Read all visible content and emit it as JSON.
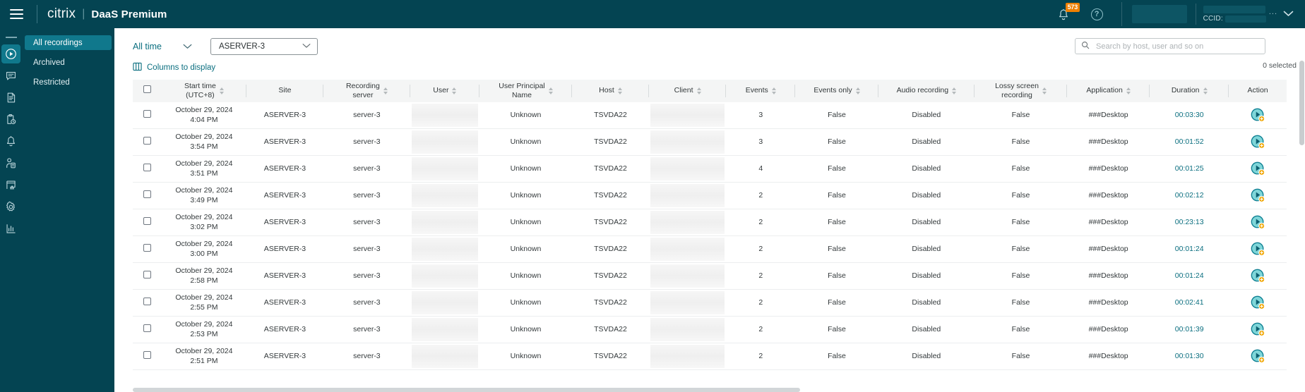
{
  "topbar": {
    "menu_icon": "hamburger-menu-icon",
    "logo": "citrix",
    "logo_separator": "|",
    "product": "DaaS Premium",
    "notification_icon": "bell-icon",
    "notification_count": "573",
    "help_icon": "help-question-icon",
    "ccid_label": "CCID:",
    "account_dots": "...",
    "account_caret_icon": "chevron-down-icon",
    "colors": {
      "bar_bg": "#044452",
      "badge": "#f08000",
      "accent": "#10788c"
    }
  },
  "rail": {
    "items": [
      {
        "name": "recordings",
        "icon": "play-circle-icon",
        "active": true
      },
      {
        "name": "messages",
        "icon": "chat-bubble-icon",
        "active": false
      },
      {
        "name": "reports",
        "icon": "document-lines-icon",
        "active": false
      },
      {
        "name": "scheduled",
        "icon": "clipboard-clock-icon",
        "active": false
      },
      {
        "name": "alerts",
        "icon": "bell-icon",
        "active": false
      },
      {
        "name": "users",
        "icon": "person-document-icon",
        "active": false
      },
      {
        "name": "monitoring",
        "icon": "monitor-warning-icon",
        "active": false
      },
      {
        "name": "settings",
        "icon": "gear-icon",
        "active": false
      },
      {
        "name": "analytics",
        "icon": "bar-chart-icon",
        "active": false
      }
    ]
  },
  "subnav": {
    "items": [
      {
        "label": "All recordings",
        "active": true
      },
      {
        "label": "Archived",
        "active": false
      },
      {
        "label": "Restricted",
        "active": false
      }
    ]
  },
  "filters": {
    "time_label": "All time",
    "time_caret_icon": "chevron-down-icon",
    "server_value": "ASERVER-3",
    "server_caret_icon": "chevron-down-icon"
  },
  "search": {
    "icon": "search-icon",
    "placeholder": "Search by host, user and so on",
    "value": ""
  },
  "toolbar": {
    "columns_icon": "columns-icon",
    "columns_label": "Columns to display",
    "selected_text": "0 selected"
  },
  "table": {
    "columns": [
      {
        "key": "check",
        "label": "",
        "sortable": false,
        "name": "select-all-checkbox-header"
      },
      {
        "key": "start",
        "label": "Start time\n(UTC+8)",
        "sortable": true,
        "name": "column-start-time"
      },
      {
        "key": "site",
        "label": "Site",
        "sortable": false,
        "name": "column-site"
      },
      {
        "key": "recsrv",
        "label": "Recording\nserver",
        "sortable": true,
        "name": "column-recording-server"
      },
      {
        "key": "user",
        "label": "User",
        "sortable": true,
        "name": "column-user"
      },
      {
        "key": "upn",
        "label": "User Principal\nName",
        "sortable": true,
        "name": "column-user-principal-name"
      },
      {
        "key": "host",
        "label": "Host",
        "sortable": true,
        "name": "column-host"
      },
      {
        "key": "client",
        "label": "Client",
        "sortable": true,
        "name": "column-client"
      },
      {
        "key": "events",
        "label": "Events",
        "sortable": true,
        "name": "column-events"
      },
      {
        "key": "evonly",
        "label": "Events only",
        "sortable": true,
        "name": "column-events-only"
      },
      {
        "key": "audio",
        "label": "Audio recording",
        "sortable": true,
        "name": "column-audio-recording"
      },
      {
        "key": "lossy",
        "label": "Lossy screen\nrecording",
        "sortable": true,
        "name": "column-lossy-screen-recording"
      },
      {
        "key": "app",
        "label": "Application",
        "sortable": true,
        "name": "column-application"
      },
      {
        "key": "dur",
        "label": "Duration",
        "sortable": true,
        "name": "column-duration"
      },
      {
        "key": "action",
        "label": "Action",
        "sortable": false,
        "name": "column-action"
      }
    ],
    "rows": [
      {
        "date": "October 29, 2024",
        "time": "4:04 PM",
        "site": "ASERVER-3",
        "recsrv": "server-3",
        "user": "",
        "upn": "Unknown",
        "host": "TSVDA22",
        "client": "",
        "events": "3",
        "evonly": "False",
        "audio": "Disabled",
        "lossy": "False",
        "app": "###Desktop",
        "dur": "00:03:30",
        "action": "play-recording-button"
      },
      {
        "date": "October 29, 2024",
        "time": "3:54 PM",
        "site": "ASERVER-3",
        "recsrv": "server-3",
        "user": "",
        "upn": "Unknown",
        "host": "TSVDA22",
        "client": "",
        "events": "3",
        "evonly": "False",
        "audio": "Disabled",
        "lossy": "False",
        "app": "###Desktop",
        "dur": "00:01:52",
        "action": "play-recording-button"
      },
      {
        "date": "October 29, 2024",
        "time": "3:51 PM",
        "site": "ASERVER-3",
        "recsrv": "server-3",
        "user": "",
        "upn": "Unknown",
        "host": "TSVDA22",
        "client": "",
        "events": "4",
        "evonly": "False",
        "audio": "Disabled",
        "lossy": "False",
        "app": "###Desktop",
        "dur": "00:01:25",
        "action": "play-recording-button"
      },
      {
        "date": "October 29, 2024",
        "time": "3:49 PM",
        "site": "ASERVER-3",
        "recsrv": "server-3",
        "user": "",
        "upn": "Unknown",
        "host": "TSVDA22",
        "client": "",
        "events": "2",
        "evonly": "False",
        "audio": "Disabled",
        "lossy": "False",
        "app": "###Desktop",
        "dur": "00:02:12",
        "action": "play-recording-button"
      },
      {
        "date": "October 29, 2024",
        "time": "3:02 PM",
        "site": "ASERVER-3",
        "recsrv": "server-3",
        "user": "",
        "upn": "Unknown",
        "host": "TSVDA22",
        "client": "",
        "events": "2",
        "evonly": "False",
        "audio": "Disabled",
        "lossy": "False",
        "app": "###Desktop",
        "dur": "00:23:13",
        "action": "play-recording-button"
      },
      {
        "date": "October 29, 2024",
        "time": "3:00 PM",
        "site": "ASERVER-3",
        "recsrv": "server-3",
        "user": "",
        "upn": "Unknown",
        "host": "TSVDA22",
        "client": "",
        "events": "2",
        "evonly": "False",
        "audio": "Disabled",
        "lossy": "False",
        "app": "###Desktop",
        "dur": "00:01:24",
        "action": "play-recording-button"
      },
      {
        "date": "October 29, 2024",
        "time": "2:58 PM",
        "site": "ASERVER-3",
        "recsrv": "server-3",
        "user": "",
        "upn": "Unknown",
        "host": "TSVDA22",
        "client": "",
        "events": "2",
        "evonly": "False",
        "audio": "Disabled",
        "lossy": "False",
        "app": "###Desktop",
        "dur": "00:01:24",
        "action": "play-recording-button"
      },
      {
        "date": "October 29, 2024",
        "time": "2:55 PM",
        "site": "ASERVER-3",
        "recsrv": "server-3",
        "user": "",
        "upn": "Unknown",
        "host": "TSVDA22",
        "client": "",
        "events": "2",
        "evonly": "False",
        "audio": "Disabled",
        "lossy": "False",
        "app": "###Desktop",
        "dur": "00:02:41",
        "action": "play-recording-button"
      },
      {
        "date": "October 29, 2024",
        "time": "2:53 PM",
        "site": "ASERVER-3",
        "recsrv": "server-3",
        "user": "",
        "upn": "Unknown",
        "host": "TSVDA22",
        "client": "",
        "events": "2",
        "evonly": "False",
        "audio": "Disabled",
        "lossy": "False",
        "app": "###Desktop",
        "dur": "00:01:39",
        "action": "play-recording-button"
      },
      {
        "date": "October 29, 2024",
        "time": "2:51 PM",
        "site": "ASERVER-3",
        "recsrv": "server-3",
        "user": "",
        "upn": "Unknown",
        "host": "TSVDA22",
        "client": "",
        "events": "2",
        "evonly": "False",
        "audio": "Disabled",
        "lossy": "False",
        "app": "###Desktop",
        "dur": "00:01:30",
        "action": "play-recording-button"
      }
    ]
  }
}
